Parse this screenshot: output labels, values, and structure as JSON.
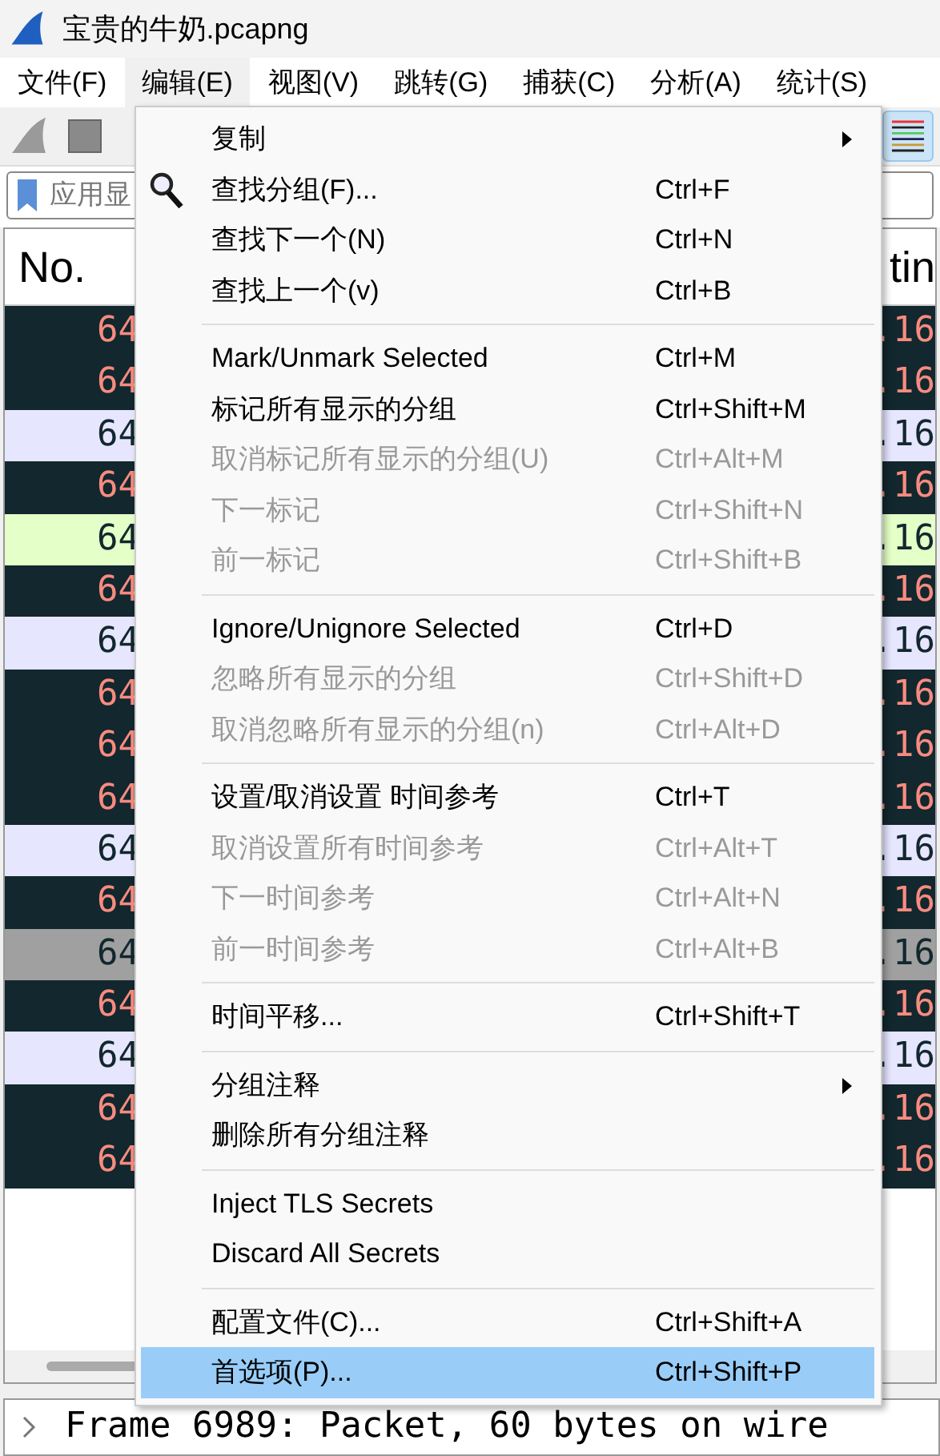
{
  "window": {
    "title": "宝贵的牛奶.pcapng"
  },
  "menubar": [
    {
      "label": "文件(F)",
      "selected": false
    },
    {
      "label": "编辑(E)",
      "selected": true
    },
    {
      "label": "视图(V)",
      "selected": false
    },
    {
      "label": "跳转(G)",
      "selected": false
    },
    {
      "label": "捕获(C)",
      "selected": false
    },
    {
      "label": "分析(A)",
      "selected": false
    },
    {
      "label": "统计(S)",
      "selected": false
    }
  ],
  "toolbar": {
    "colorize": {
      "on": true
    }
  },
  "filter": {
    "placeholder": "应用显"
  },
  "packet_list": {
    "columns": [
      "No.",
      "tin"
    ],
    "rows": [
      {
        "kind": "dark",
        "column_1": "64",
        "column_2": ".16"
      },
      {
        "kind": "dark",
        "column_1": "64",
        "column_2": ".16"
      },
      {
        "kind": "lavender",
        "column_1": "64",
        "column_2": ".16"
      },
      {
        "kind": "dark",
        "column_1": "64",
        "column_2": ".16"
      },
      {
        "kind": "green",
        "column_1": "64",
        "column_2": ".16"
      },
      {
        "kind": "dark",
        "column_1": "64",
        "column_2": ".16"
      },
      {
        "kind": "lavender",
        "column_1": "64",
        "column_2": ".16"
      },
      {
        "kind": "dark",
        "column_1": "64",
        "column_2": ".16"
      },
      {
        "kind": "dark",
        "column_1": "64",
        "column_2": ".16"
      },
      {
        "kind": "dark",
        "column_1": "64",
        "column_2": ".16"
      },
      {
        "kind": "lavender",
        "column_1": "64",
        "column_2": ".16"
      },
      {
        "kind": "dark",
        "column_1": "64",
        "column_2": ".16"
      },
      {
        "kind": "grey",
        "column_1": "64",
        "column_2": ".16"
      },
      {
        "kind": "dark",
        "column_1": "64",
        "column_2": ".16"
      },
      {
        "kind": "lavender",
        "column_1": "64",
        "column_2": ".16"
      },
      {
        "kind": "dark",
        "column_1": "64",
        "column_2": ".16"
      },
      {
        "kind": "dark",
        "column_1": "64",
        "column_2": ".16"
      }
    ]
  },
  "detail": {
    "text": "Frame 6989: Packet, 60 bytes on wire",
    "expanded": false
  },
  "edit_menu": {
    "sections": [
      [
        {
          "label": "复制",
          "submenu": true,
          "icon": false,
          "disabled": false,
          "selected": false
        },
        {
          "label": "查找分组(F)...",
          "shortcut": "Ctrl+F",
          "submenu": false,
          "icon": true,
          "disabled": false,
          "selected": false
        },
        {
          "label": "查找下一个(N)",
          "shortcut": "Ctrl+N",
          "submenu": false,
          "icon": false,
          "disabled": false,
          "selected": false
        },
        {
          "label": "查找上一个(v)",
          "shortcut": "Ctrl+B",
          "submenu": false,
          "icon": false,
          "disabled": false,
          "selected": false
        }
      ],
      [
        {
          "label": "Mark/Unmark Selected",
          "shortcut": "Ctrl+M",
          "submenu": false,
          "icon": false,
          "disabled": false,
          "selected": false
        },
        {
          "label": "标记所有显示的分组",
          "shortcut": "Ctrl+Shift+M",
          "submenu": false,
          "icon": false,
          "disabled": false,
          "selected": false
        },
        {
          "label": "取消标记所有显示的分组(U)",
          "shortcut": "Ctrl+Alt+M",
          "submenu": false,
          "icon": false,
          "disabled": true,
          "selected": false
        },
        {
          "label": "下一标记",
          "shortcut": "Ctrl+Shift+N",
          "submenu": false,
          "icon": false,
          "disabled": true,
          "selected": false
        },
        {
          "label": "前一标记",
          "shortcut": "Ctrl+Shift+B",
          "submenu": false,
          "icon": false,
          "disabled": true,
          "selected": false
        }
      ],
      [
        {
          "label": "Ignore/Unignore Selected",
          "shortcut": "Ctrl+D",
          "submenu": false,
          "icon": false,
          "disabled": false,
          "selected": false
        },
        {
          "label": "忽略所有显示的分组",
          "shortcut": "Ctrl+Shift+D",
          "submenu": false,
          "icon": false,
          "disabled": true,
          "selected": false
        },
        {
          "label": "取消忽略所有显示的分组(n)",
          "shortcut": "Ctrl+Alt+D",
          "submenu": false,
          "icon": false,
          "disabled": true,
          "selected": false
        }
      ],
      [
        {
          "label": "设置/取消设置 时间参考",
          "shortcut": "Ctrl+T",
          "submenu": false,
          "icon": false,
          "disabled": false,
          "selected": false
        },
        {
          "label": "取消设置所有时间参考",
          "shortcut": "Ctrl+Alt+T",
          "submenu": false,
          "icon": false,
          "disabled": true,
          "selected": false
        },
        {
          "label": "下一时间参考",
          "shortcut": "Ctrl+Alt+N",
          "submenu": false,
          "icon": false,
          "disabled": true,
          "selected": false
        },
        {
          "label": "前一时间参考",
          "shortcut": "Ctrl+Alt+B",
          "submenu": false,
          "icon": false,
          "disabled": true,
          "selected": false
        }
      ],
      [
        {
          "label": "时间平移...",
          "shortcut": "Ctrl+Shift+T",
          "submenu": false,
          "icon": false,
          "disabled": false,
          "selected": false
        }
      ],
      [
        {
          "label": "分组注释",
          "submenu": true,
          "icon": false,
          "disabled": false,
          "selected": false
        },
        {
          "label": "删除所有分组注释",
          "submenu": false,
          "icon": false,
          "disabled": false,
          "selected": false
        }
      ],
      [
        {
          "label": "Inject TLS Secrets",
          "submenu": false,
          "icon": false,
          "disabled": false,
          "selected": false
        },
        {
          "label": "Discard All Secrets",
          "submenu": false,
          "icon": false,
          "disabled": false,
          "selected": false
        }
      ],
      [
        {
          "label": "配置文件(C)...",
          "shortcut": "Ctrl+Shift+A",
          "submenu": false,
          "icon": false,
          "disabled": false,
          "selected": false
        },
        {
          "label": "首选项(P)...",
          "shortcut": "Ctrl+Shift+P",
          "submenu": false,
          "icon": false,
          "disabled": false,
          "selected": true
        }
      ]
    ]
  }
}
